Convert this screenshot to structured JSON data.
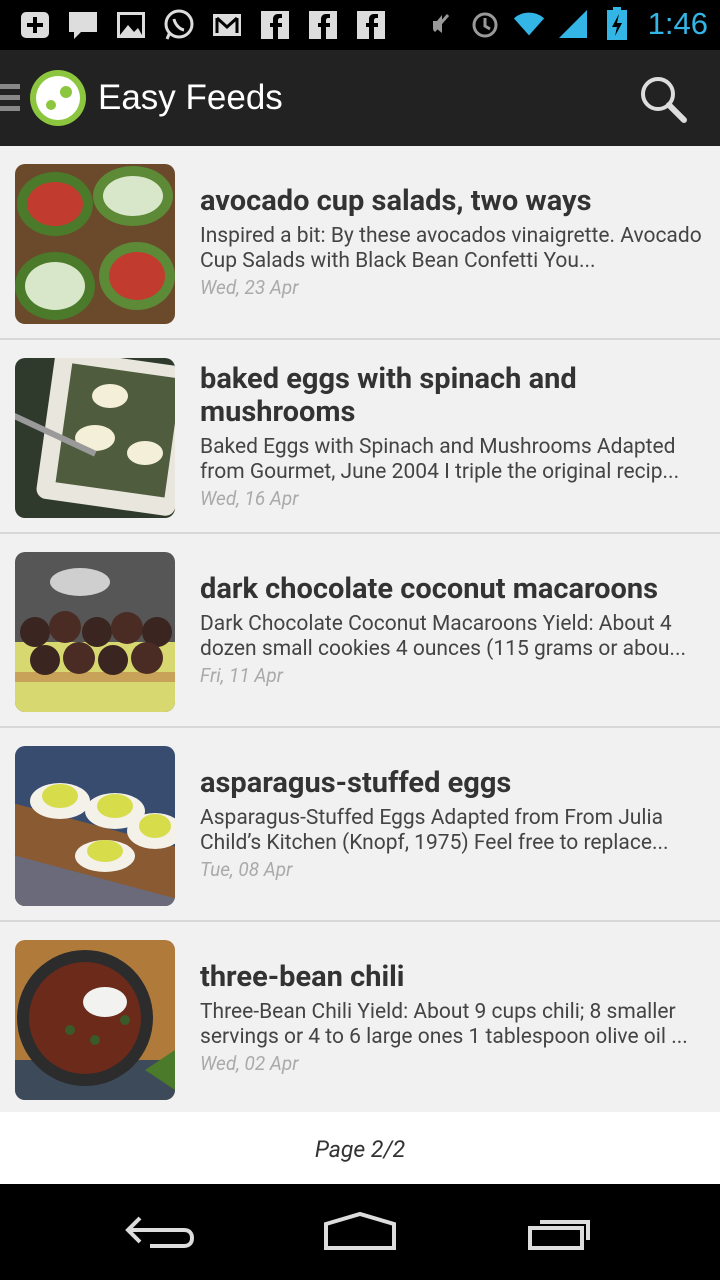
{
  "status_bar": {
    "time": "1:46",
    "notification_icons": [
      "add-icon",
      "chat-icon",
      "image-icon",
      "whatsapp-icon",
      "gmail-icon",
      "facebook-icon",
      "facebook-icon",
      "facebook-icon"
    ],
    "system_icons": [
      "mute-icon",
      "alarm-icon",
      "wifi-icon",
      "signal-icon",
      "battery-icon"
    ]
  },
  "action_bar": {
    "title": "Easy Feeds"
  },
  "feed": [
    {
      "title": "avocado cup salads, two ways",
      "summary": "Inspired a bit: By these avocados vinaigrette. Avocado Cup Salads with Black Bean Confetti You...",
      "date": "Wed, 23 Apr",
      "thumb_colors": [
        "#4a7a2a",
        "#d8e7c9",
        "#c23b2f"
      ]
    },
    {
      "title": "baked eggs with spinach and mushrooms",
      "summary": "Baked Eggs with Spinach and Mushrooms Adapted from Gourmet, June 2004 I triple the original recip...",
      "date": "Wed, 16 Apr",
      "thumb_colors": [
        "#2f3a2c",
        "#e9e6de",
        "#6b7760"
      ]
    },
    {
      "title": "dark chocolate coconut macaroons",
      "summary": "Dark Chocolate Coconut Macaroons Yield: About 4 dozen small cookies 4 ounces (115 grams or abou...",
      "date": "Fri, 11 Apr",
      "thumb_colors": [
        "#3b2520",
        "#d8d870",
        "#565656"
      ]
    },
    {
      "title": "asparagus-stuffed eggs",
      "summary": "Asparagus-Stuffed Eggs Adapted from From Julia Child’s Kitchen (Knopf, 1975) Feel free to replace...",
      "date": "Tue, 08 Apr",
      "thumb_colors": [
        "#384c70",
        "#d7dd4a",
        "#f3f1e8"
      ]
    },
    {
      "title": "three-bean chili",
      "summary": "Three-Bean Chili Yield: About 9 cups chili; 8 smaller servings or 4 to 6 large ones 1 tablespoon olive oil ...",
      "date": "Wed, 02 Apr",
      "thumb_colors": [
        "#2c2c2c",
        "#6b2a1a",
        "#f2f2f0"
      ]
    }
  ],
  "pagination": {
    "label": "Page 2/2"
  },
  "nav_bar": {
    "buttons": [
      "back-icon",
      "home-icon",
      "recent-apps-icon"
    ]
  },
  "colors": {
    "accent": "#8cc63f",
    "time": "#33b5e5",
    "action_bar_bg": "#222222"
  }
}
